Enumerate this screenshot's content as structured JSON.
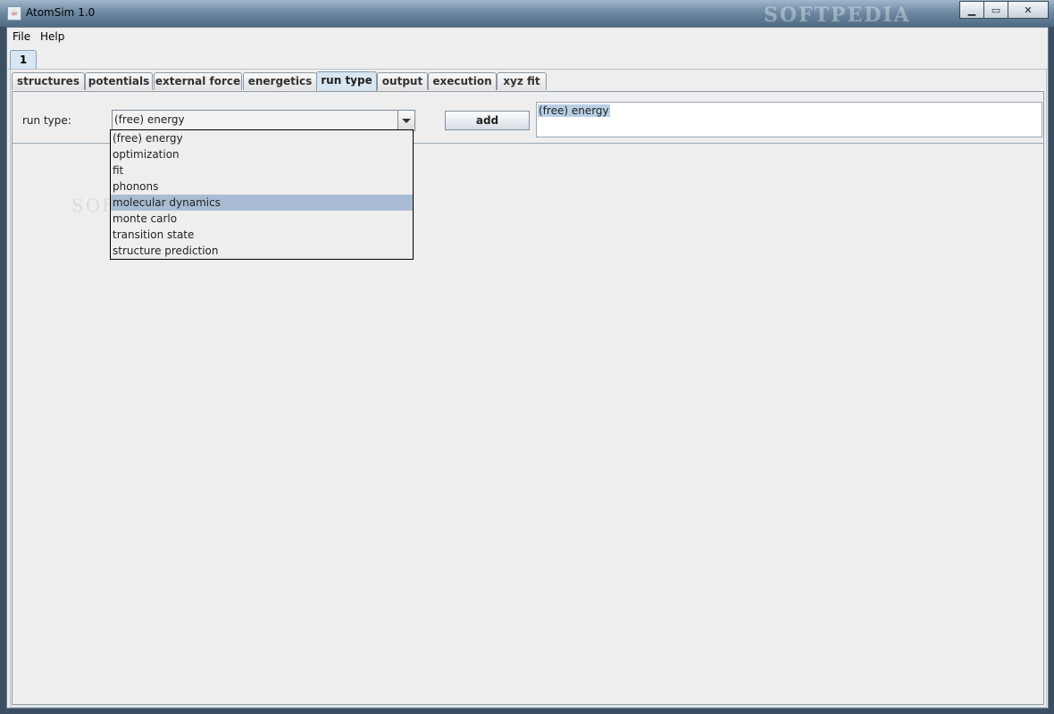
{
  "window": {
    "title": "AtomSim 1.0",
    "watermark": "SOFTPEDIA"
  },
  "menu": [
    {
      "label": "File"
    },
    {
      "label": "Help"
    }
  ],
  "doc_tabs": [
    {
      "label": "1"
    }
  ],
  "tabs": [
    {
      "label": "structures"
    },
    {
      "label": "potentials"
    },
    {
      "label": "external force"
    },
    {
      "label": "energetics"
    },
    {
      "label": "run type"
    },
    {
      "label": "output"
    },
    {
      "label": "execution"
    },
    {
      "label": "xyz fit"
    }
  ],
  "active_tab": "run type",
  "run_type": {
    "label": "run type:",
    "selected": "(free) energy",
    "options": [
      "(free) energy",
      "optimization",
      "fit",
      "phonons",
      "molecular dynamics",
      "monte carlo",
      "transition state",
      "structure prediction"
    ],
    "highlighted": "molecular dynamics"
  },
  "add_button": "add",
  "selected_list": [
    "(free) energy"
  ]
}
